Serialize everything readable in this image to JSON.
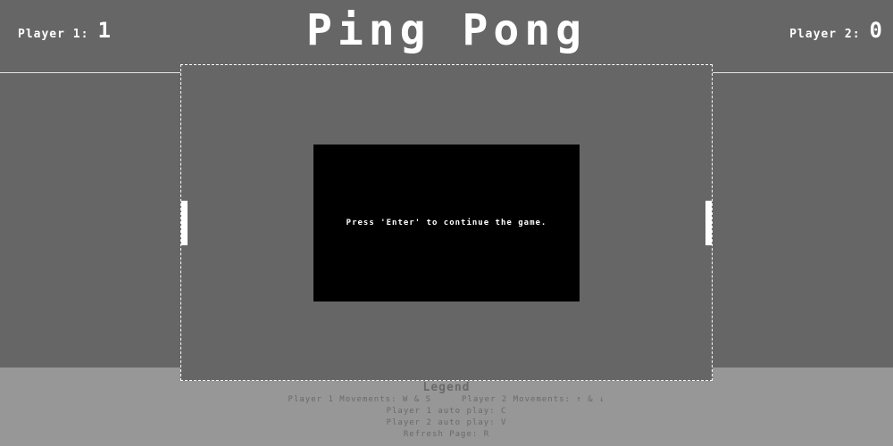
{
  "header": {
    "title": "Ping Pong",
    "player1": {
      "label": "Player 1:",
      "score": "1"
    },
    "player2": {
      "label": "Player 2:",
      "score": "0"
    }
  },
  "game": {
    "pause_message": "Press 'Enter' to continue the game."
  },
  "legend": {
    "title": "Legend",
    "p1_movement": "Player 1 Movements: W & S",
    "p2_movement": "Player 2 Movements: ↑ & ↓",
    "p1_auto": "Player 1 auto play: C",
    "p2_auto": "Player 2 auto play: V",
    "refresh": "Refresh Page: R"
  },
  "colors": {
    "background": "#666666",
    "legend_background": "#979797",
    "paddle": "#ffffff",
    "dialog": "#000000"
  }
}
